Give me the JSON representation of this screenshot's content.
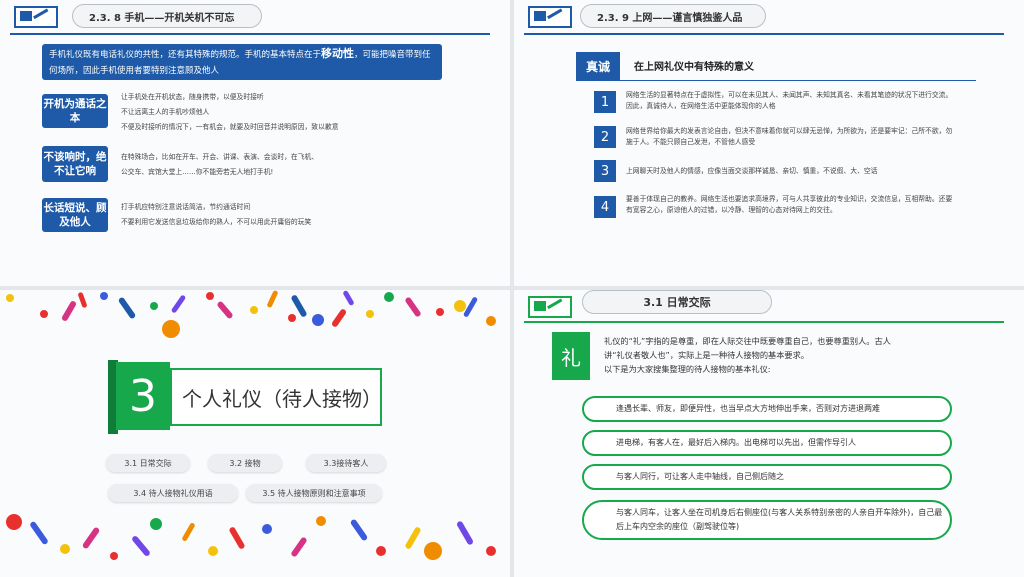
{
  "slide1": {
    "title": "2.3. 8 手机——开机关机不可忘",
    "intro_pre": "手机礼仪既有电话礼仪的共性，还有其特殊的规范。手机的基本特点在于",
    "intro_strong": "移动性",
    "intro_post": "，可能把噪音带到任何场所，因此手机使用者要特别注意顾及他人",
    "items": [
      {
        "tag": "开机为通话之本",
        "lines": [
          "让手机处在开机状态，随身携带，以便及时接听",
          "不让远离主人的手机吵烦他人",
          "不便及时接听的情况下，一有机会，就要及时回音并说明原因，致以歉意"
        ]
      },
      {
        "tag": "不该响时，绝不让它响",
        "lines": [
          "在特殊场合，比如在开车、开会、讲课、表演、会谈时，在飞机、",
          "公交车、宾馆大堂上……你不能旁若无人地打手机!"
        ]
      },
      {
        "tag": "长话短说、顾及他人",
        "lines": [
          "打手机应特别注意说话简洁，节约通话时间",
          "不要利用它发送信息垃圾给你的熟人，不可以用此开庸俗的玩笑"
        ]
      }
    ]
  },
  "slide2": {
    "title": "2.3. 9 上网——谨言慎独鉴人品",
    "label": "真诚",
    "subtitle": "在上网礼仪中有特殊的意义",
    "items": [
      {
        "num": "1",
        "text": "网络生活的显著特点在于虚拟性，可以在未见其人、未闻其声、未知其真名、未看其笔迹的状况下进行交流。因此，真诚待人，在网络生活中更能体现你的人格"
      },
      {
        "num": "2",
        "text": "网络世界给你最大的发表言论自由，但决不意味着你就可以肆无忌惮，为所欲为，还是要牢记：己所不欲，勿施于人。不能只顾自己发泄，不管他人感受"
      },
      {
        "num": "3",
        "text": "上网聊天时及他人的情感，应像当面交谈那样诚恳、亲切、慎重，不说假、大、空话"
      },
      {
        "num": "4",
        "text": "要善于体现自己的教养。网络生活也要追求高境界，可与人共享彼此的专业知识，交流信息，互相帮助。还要有宽容之心，原谅他人的过错，以冷静、理智的心态对待网上的交往。"
      }
    ]
  },
  "slide3": {
    "number": "3",
    "title": "个人礼仪（待人接物）",
    "pills": [
      "3.1 日常交际",
      "3.2 接物",
      "3.3接待客人",
      "3.4 待人接物礼仪用语",
      "3.5 待人接物原则和注意事项"
    ]
  },
  "slide4": {
    "title": "3.1  日常交际",
    "char": "礼",
    "intro": [
      "礼仪的“礼”字指的是尊重，即在人际交往中既要尊重自己，也要尊重别人。古人",
      "讲“礼仪者敬人也”，实际上是一种待人接物的基本要求。",
      "以下是为大家搜集整理的待人接物的基本礼仪:"
    ],
    "rules": [
      "逢遇长辈、师友，即便异性，也当早点大方地伸出手来，否则对方进退两难",
      "进电梯，有客人在，最好后入梯内。出电梯可以先出，但需作导引人",
      "与客人同行，可让客人走中轴线，自己侧后随之",
      "与客人同车，让客人坐在司机身后右侧座位(与客人关系特别亲密的人亲自开车除外)，自己最后上车内空余的座位（副驾驶位等)"
    ]
  },
  "colors": {
    "blue": "#1e5aa8",
    "green": "#17a84b"
  }
}
